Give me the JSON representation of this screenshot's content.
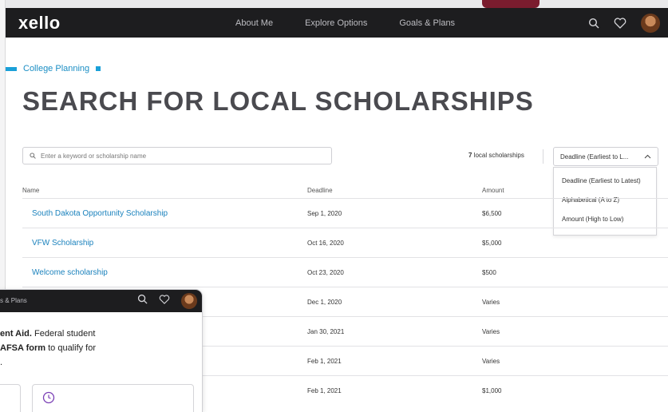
{
  "app": {
    "logo": "xello"
  },
  "nav": {
    "items": [
      "About Me",
      "Explore Options",
      "Goals & Plans"
    ]
  },
  "icons": {
    "search": "search-icon",
    "favorites": "heart-icon",
    "avatar": "avatar"
  },
  "breadcrumb": {
    "label": "College Planning"
  },
  "page": {
    "title": "SEARCH FOR LOCAL SCHOLARSHIPS"
  },
  "search": {
    "placeholder": "Enter a keyword or scholarship name",
    "value": ""
  },
  "results": {
    "count": "7",
    "count_suffix": "local scholarships"
  },
  "sort": {
    "selected": "Deadline (Earliest to L...",
    "options": [
      "Deadline (Earliest to Latest)",
      "Alphabetical (A to Z)",
      "Amount (High to Low)"
    ]
  },
  "table": {
    "headers": {
      "name": "Name",
      "deadline": "Deadline",
      "amount": "Amount"
    },
    "rows": [
      {
        "name": "South Dakota Opportunity Scholarship",
        "deadline": "Sep 1, 2020",
        "amount": "$6,500"
      },
      {
        "name": "VFW Scholarship",
        "deadline": "Oct 16, 2020",
        "amount": "$5,000"
      },
      {
        "name": "Welcome scholarship",
        "deadline": "Oct 23, 2020",
        "amount": "$500"
      },
      {
        "name": "",
        "deadline": "Dec 1, 2020",
        "amount": "Varies"
      },
      {
        "name": "",
        "deadline": "Jan 30, 2021",
        "amount": "Varies"
      },
      {
        "name": "",
        "deadline": "Feb 1, 2021",
        "amount": "Varies"
      },
      {
        "name": "",
        "deadline": "Feb 1, 2021",
        "amount": "$1,000"
      }
    ]
  },
  "overlay": {
    "nav_fragment": "s & Plans",
    "line1_bold": "ent Aid.",
    "line1_rest": " Federal student",
    "line2_bold": "AFSA form",
    "line2_rest": " to qualify for",
    "line3": "."
  },
  "colors": {
    "topbar": "#1d1d1f",
    "accent": "#1aa0d8",
    "link": "#1b82bd",
    "title": "#4a4a4f"
  }
}
